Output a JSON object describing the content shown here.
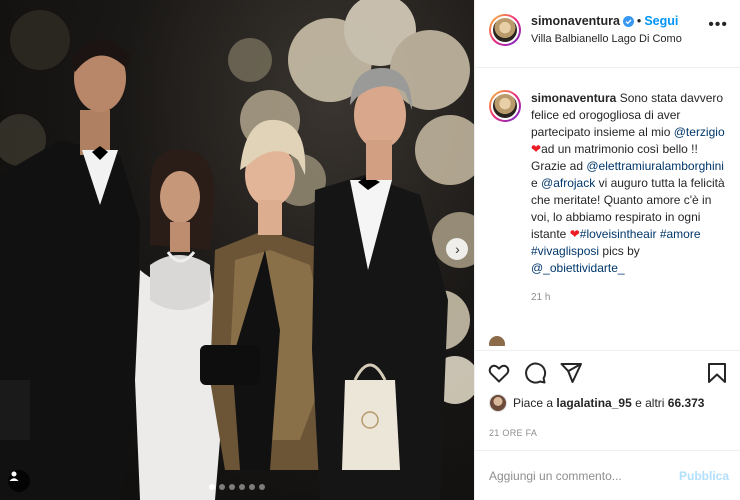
{
  "post": {
    "username": "simonaventura",
    "follow_label": "Segui",
    "location": "Villa Balbianello Lago Di Como",
    "more_label": "•••"
  },
  "caption": {
    "username": "simonaventura",
    "part1": "Sono stata davvero felice ed orogogliosa di aver partecipato insieme al mio",
    "mention1": "@terzigio",
    "part2": "ad un matrimonio così bello !! Grazie ad",
    "mention2": "@elettramiuralamborghini",
    "part3": "e",
    "mention3": "@afrojack",
    "part4": "vi auguro tutta la felicità che meritate! Quanto amore c'è in voi, lo abbiamo respirato in ogni istante",
    "hashtag1": "#loveisintheair",
    "hashtag2": "#amore",
    "hashtag3": "#vivaglisposi",
    "part5": "pics by",
    "mention4": "@_obiettividarte_",
    "time": "21 h"
  },
  "likes": {
    "prefix": "Piace a",
    "user": "lagalatina_95",
    "middle": "e altri",
    "count": "66.373"
  },
  "posted_ago": "21 ORE FA",
  "comment": {
    "placeholder": "Aggiungi un commento...",
    "publish_label": "Pubblica"
  },
  "carousel": {
    "total": 6,
    "active_index": 0
  },
  "icons": [
    "verified-icon",
    "more-icon",
    "heart-icon",
    "comment-icon",
    "share-icon",
    "bookmark-icon",
    "next-arrow-icon",
    "user-tag-icon"
  ],
  "colors": {
    "link": "#00376b",
    "follow": "#0095f6",
    "publish": "#b2dffc",
    "heart": "#ed1c24"
  }
}
